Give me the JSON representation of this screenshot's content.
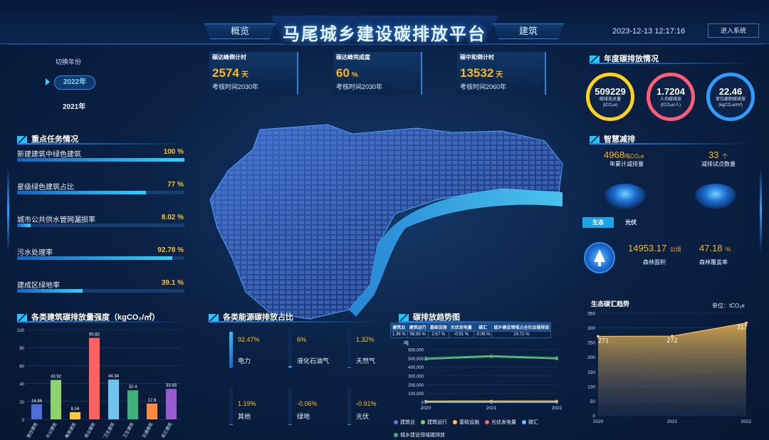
{
  "header": {
    "title": "马尾城乡建设碳排放平台",
    "tab_left": "概览",
    "tab_right": "建筑",
    "datetime": "2023-12-13 12:17:16",
    "login": "进入系统"
  },
  "year_switch": {
    "label": "切换年份",
    "active": "2022年",
    "other": "2021年"
  },
  "countdowns": [
    {
      "title": "碳达峰倒计时",
      "value": "2574",
      "unit": "天",
      "sub": "考核时间2030年"
    },
    {
      "title": "碳达峰完成度",
      "value": "60",
      "unit": "%",
      "sub": "考核时间2030年"
    },
    {
      "title": "碳中和倒计时",
      "value": "13532",
      "unit": "天",
      "sub": "考核时间2060年"
    }
  ],
  "tasks": {
    "title": "重点任务情况",
    "items": [
      {
        "label": "新建建筑中绿色建筑",
        "value": "100 %",
        "fill": 1.0
      },
      {
        "label": "星级绿色建筑占比",
        "value": "77 %",
        "fill": 0.77
      },
      {
        "label": "城市公共供水管网漏损率",
        "value": "8.02 %",
        "fill": 0.0802
      },
      {
        "label": "污水处理率",
        "value": "92.78 %",
        "fill": 0.9278
      },
      {
        "label": "建成区绿地率",
        "value": "39.1 %",
        "fill": 0.391
      }
    ]
  },
  "annual": {
    "title": "年度碳排放情况",
    "circles": [
      {
        "value": "509229",
        "l1": "碳排放总量",
        "l2": "(tCO₂e)",
        "color": "#ffd21f"
      },
      {
        "value": "1.7204",
        "l1": "人均碳排放",
        "l2": "(tCO₂e/人)",
        "color": "#ff5d73"
      },
      {
        "value": "22.46",
        "l1": "单位面积碳排放",
        "l2": "(kgCO₂e/m²)",
        "color": "#2f9cff"
      }
    ]
  },
  "smart": {
    "title": "智慧减排",
    "left_value": "4968",
    "left_unit": "吨CO₂e",
    "left_label": "年累计减排量",
    "right_value": "33",
    "right_unit": "个",
    "right_label": "减排试点数量",
    "toggle_active": "生态",
    "toggle_other": "光伏",
    "forest_area_value": "14953.17",
    "forest_area_unit": "公顷",
    "forest_area_label": "森林面积",
    "forest_cover_value": "47.18",
    "forest_cover_unit": "%",
    "forest_cover_label": "森林覆盖率"
  },
  "building_intensity": {
    "title": "各类建筑碳排放量强度（kgCO₂/㎡）"
  },
  "energy_share": {
    "title": "各类能源碳排放占比",
    "items": [
      {
        "pct": "92.47%",
        "name": "电力",
        "fill": 0.9247
      },
      {
        "pct": "6%",
        "name": "液化石油气",
        "fill": 0.06
      },
      {
        "pct": "1.32%",
        "name": "天然气",
        "fill": 0.0132
      },
      {
        "pct": "1.19%",
        "name": "其他",
        "fill": 0.0119
      },
      {
        "pct": "-0.06%",
        "name": "绿地",
        "fill": 0.0
      },
      {
        "pct": "-0.91%",
        "name": "光伏",
        "fill": 0.0
      }
    ]
  },
  "trend": {
    "title": "碳排放趋势图",
    "table_headers": [
      "建筑业",
      "建筑运行",
      "基础设施",
      "光伏发电量",
      "碳汇",
      "城乡建设领域占全社会碳排放"
    ],
    "table_values": [
      "1.36 %",
      "96.95 %",
      "2.67 %",
      "-0.91 %",
      "-0.06 %",
      "24.72 %"
    ],
    "unit_label": "吨"
  },
  "sink": {
    "title": "生态碳汇趋势",
    "unit": "单位：tCO₂e"
  },
  "chart_data": [
    {
      "type": "bar",
      "title": "各类建筑碳排放量强度（kgCO₂/㎡）",
      "categories": [
        "居住建筑",
        "办公建筑",
        "教育建筑",
        "商业建筑",
        "医疗卫生建筑",
        "卫生建筑",
        "交通建筑",
        "其它建筑"
      ],
      "values": [
        16.86,
        43.92,
        8.04,
        90.82,
        44.34,
        32.4,
        17.6,
        33.93
      ],
      "colors": [
        "#4f6fd8",
        "#8ed26b",
        "#ffc83a",
        "#ff6060",
        "#6fc3ee",
        "#3fb07a",
        "#ff8a3d",
        "#9a5bd1"
      ],
      "ylim": [
        0,
        100
      ],
      "yticks": [
        0,
        20,
        40,
        60,
        80,
        100
      ]
    },
    {
      "type": "line",
      "title": "碳排放趋势图",
      "x": [
        "2020",
        "2021",
        "2022"
      ],
      "ylabel": "吨",
      "ylim": [
        0,
        600000
      ],
      "yticks": [
        0,
        100000,
        200000,
        300000,
        400000,
        500000,
        600000
      ],
      "ytick_labels": [
        "0",
        "100,000",
        "200,000",
        "300,000",
        "400,000",
        "500,000",
        "600,000"
      ],
      "series": [
        {
          "name": "建筑业",
          "values": [
            8000,
            8000,
            7000
          ],
          "color": "#5a78e0"
        },
        {
          "name": "建筑运行",
          "values": [
            490000,
            520000,
            495000
          ],
          "color": "#7ad26b"
        },
        {
          "name": "基础设施",
          "values": [
            13000,
            14000,
            13500
          ],
          "color": "#ffc83a"
        },
        {
          "name": "光伏发电量",
          "values": [
            -3000,
            -4000,
            -4600
          ],
          "color": "#ff6060"
        },
        {
          "name": "碳汇",
          "values": [
            -271,
            -272,
            -317
          ],
          "color": "#6fc3ee"
        },
        {
          "name": "城乡建设领域碳排放",
          "values": [
            505000,
            530000,
            509229
          ],
          "color": "#3fb07a"
        }
      ]
    },
    {
      "type": "area",
      "title": "生态碳汇趋势",
      "x": [
        "2020",
        "2021",
        "2022"
      ],
      "values": [
        271,
        272,
        317
      ],
      "ylim": [
        0,
        350
      ],
      "yticks": [
        0,
        50,
        100,
        150,
        200,
        250,
        300,
        350
      ]
    }
  ]
}
